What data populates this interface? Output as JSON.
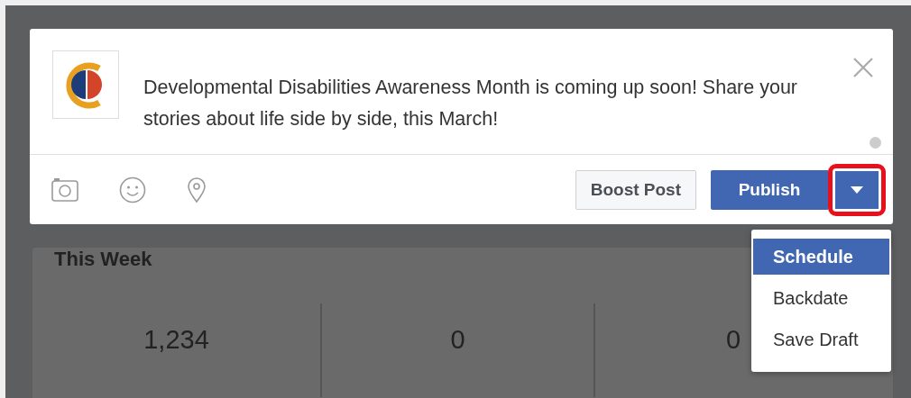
{
  "composer": {
    "message": "Developmental Disabilities Awareness Month is coming up soon! Share your stories about life side by side, this March!"
  },
  "actions": {
    "boost": "Boost Post",
    "publish": "Publish"
  },
  "menu": [
    {
      "label": "Schedule",
      "selected": true
    },
    {
      "label": "Backdate",
      "selected": false
    },
    {
      "label": "Save Draft",
      "selected": false
    }
  ],
  "stats": {
    "title": "This Week",
    "values": [
      "1,234",
      "0",
      "0"
    ]
  }
}
